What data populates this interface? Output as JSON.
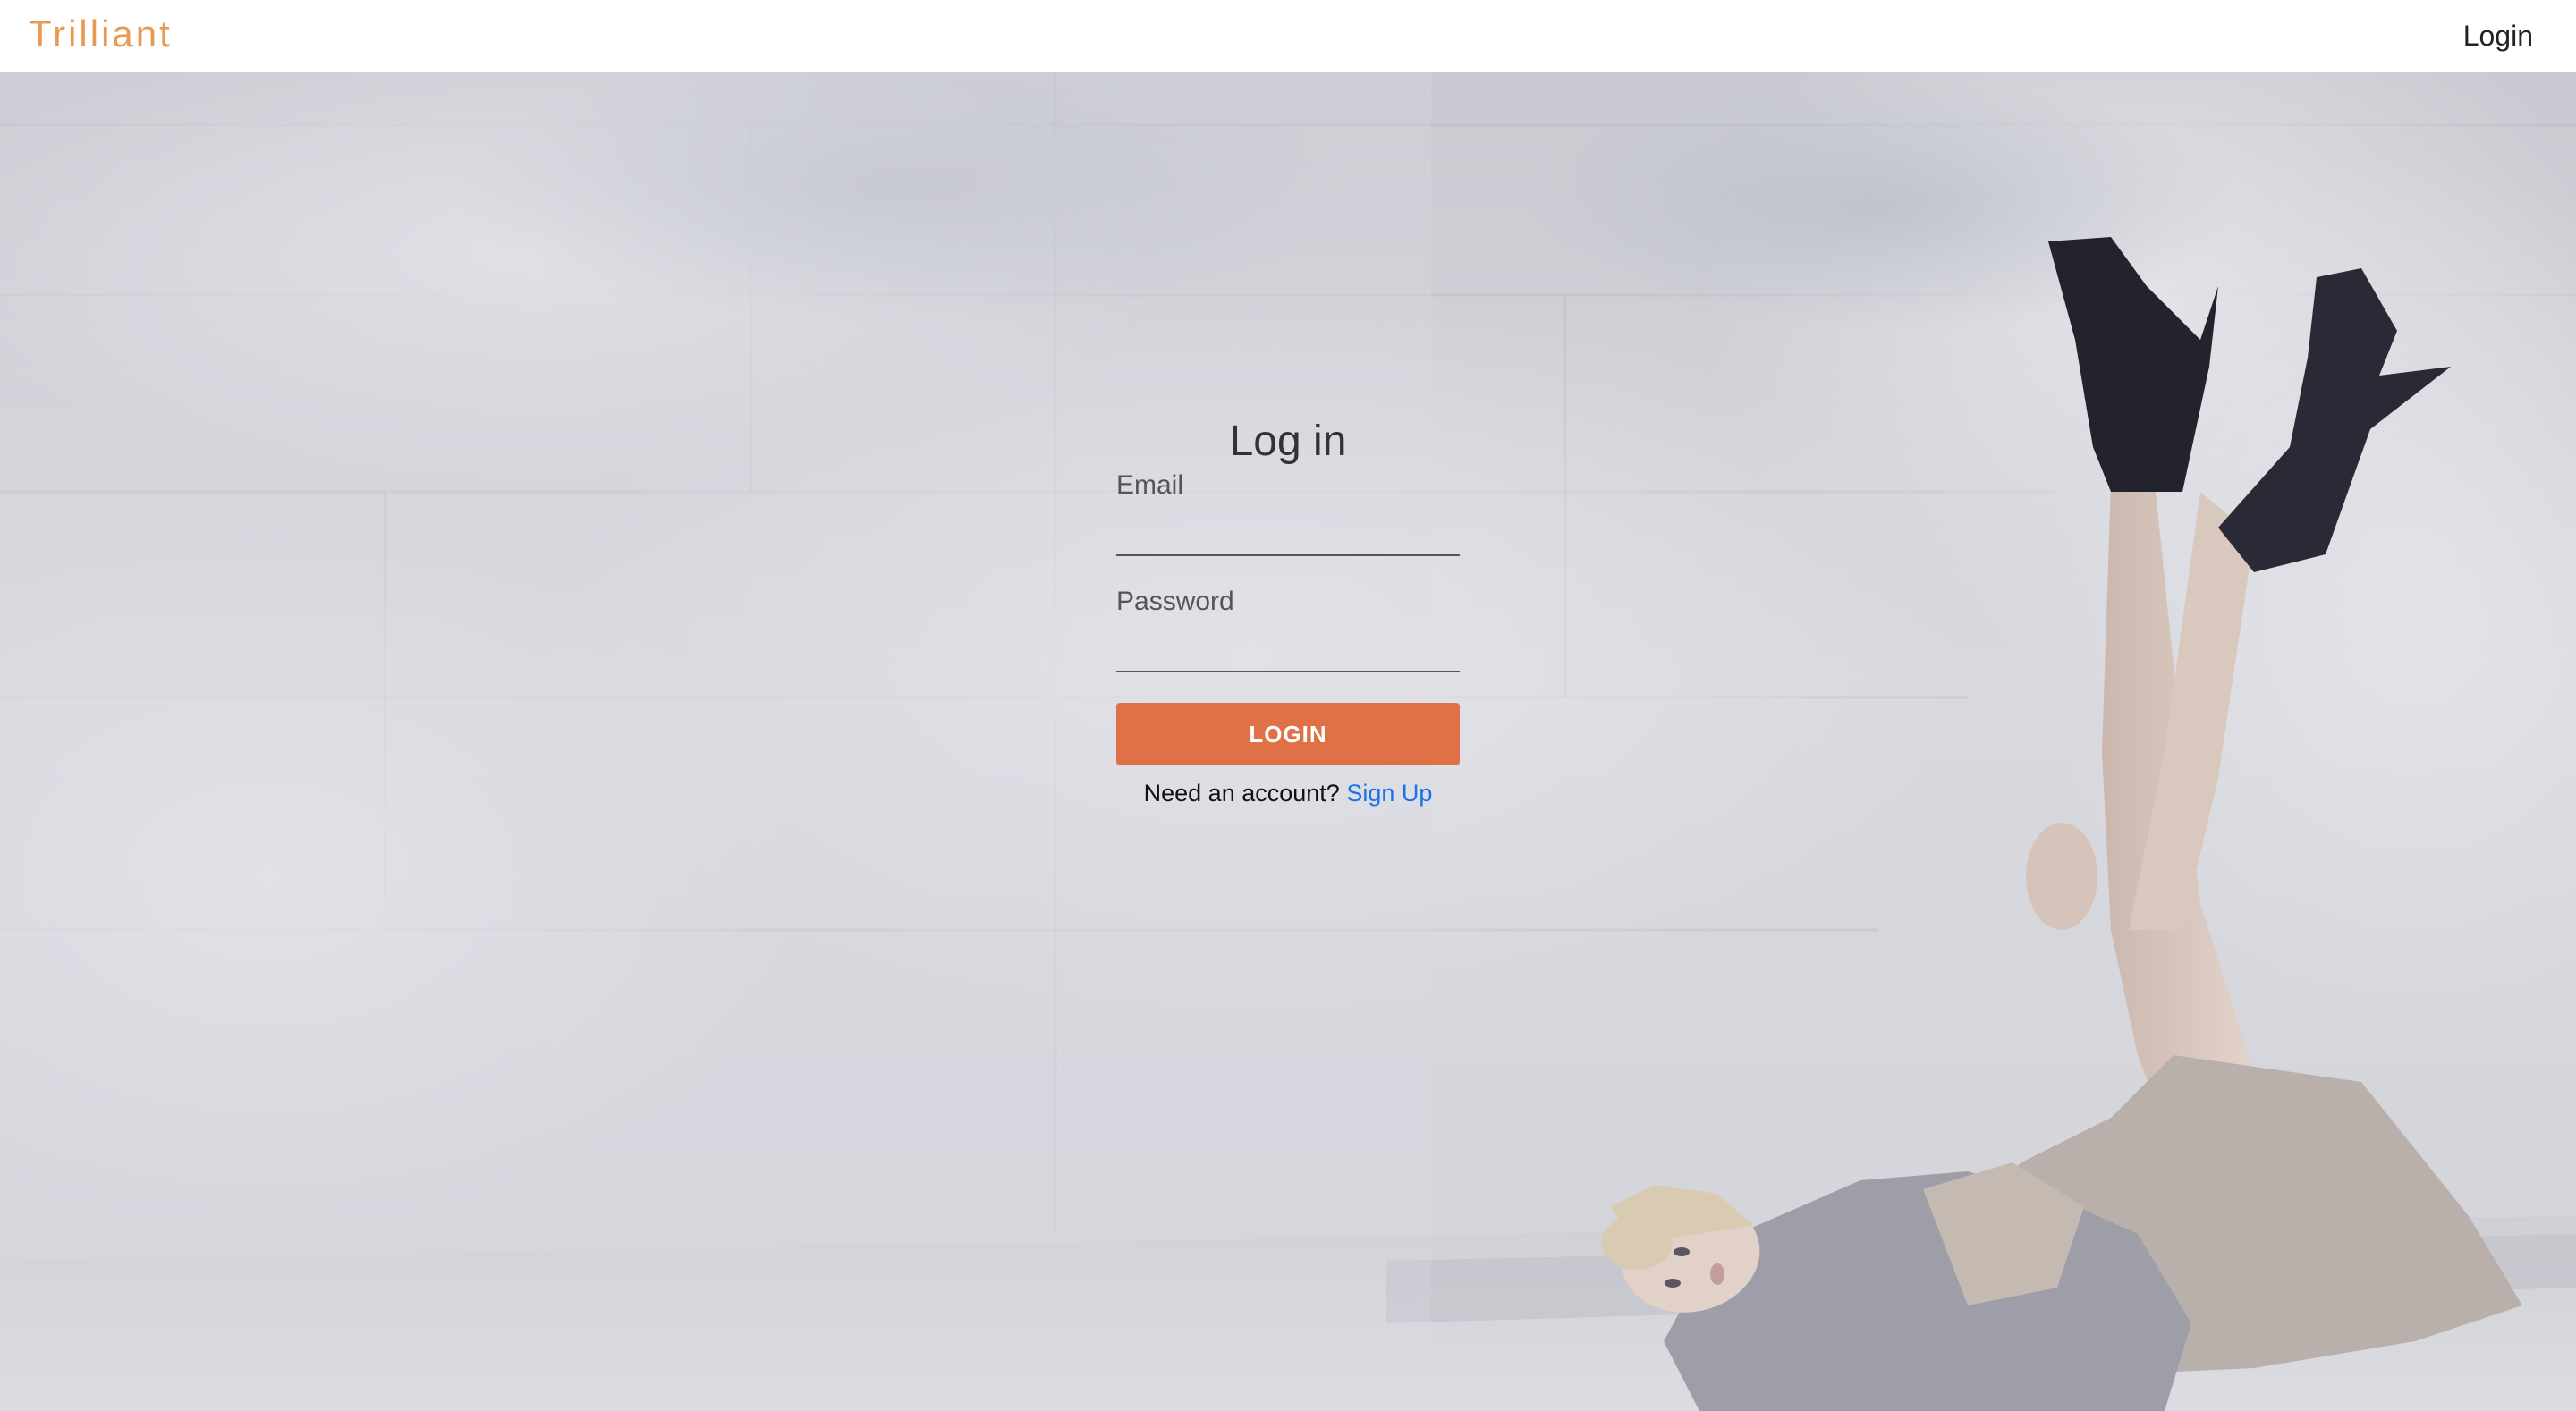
{
  "navbar": {
    "brand": "Trilliant",
    "login_link": "Login"
  },
  "form": {
    "title": "Log in",
    "email_label": "Email",
    "email_value": "",
    "password_label": "Password",
    "password_value": "",
    "submit_label": "LOGIN",
    "signup_prompt": "Need an account?",
    "signup_link": "Sign Up"
  },
  "colors": {
    "brand": "#e89a52",
    "button": "#e07046",
    "link": "#1a73e8"
  }
}
